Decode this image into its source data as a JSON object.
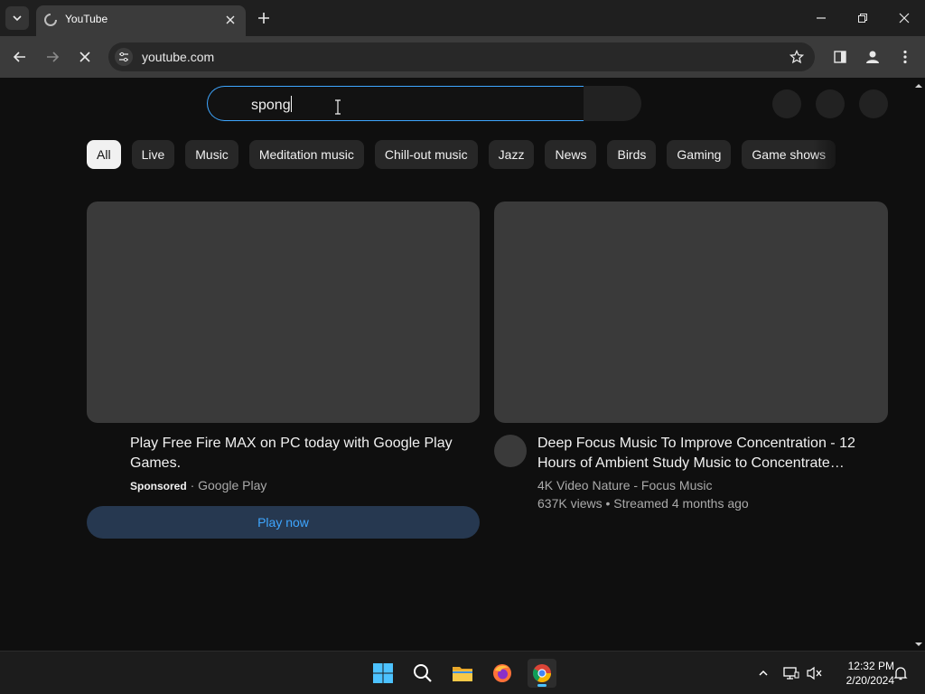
{
  "browser": {
    "tab_title": "YouTube",
    "url": "youtube.com"
  },
  "youtube": {
    "search_query": "spong",
    "chips": [
      "All",
      "Live",
      "Music",
      "Meditation music",
      "Chill-out music",
      "Jazz",
      "News",
      "Birds",
      "Gaming",
      "Game shows"
    ],
    "active_chip": "All",
    "videos": [
      {
        "title": "Play Free Fire MAX on PC today with Google Play Games.",
        "sponsored_label": "Sponsored",
        "separator": "·",
        "advertiser": "Google Play",
        "cta_label": "Play now"
      },
      {
        "title": "Deep Focus Music To Improve Concentration - 12 Hours of Ambient Study Music to Concentrate…",
        "channel": "4K Video Nature - Focus Music",
        "stats": "637K views • Streamed 4 months ago"
      }
    ]
  },
  "taskbar": {
    "time": "12:32 PM",
    "date": "2/20/2024",
    "apps": [
      "windows-start",
      "search",
      "file-explorer",
      "firefox",
      "chrome"
    ],
    "active_app": "chrome"
  },
  "colors": {
    "page_bg": "#0f0f0f",
    "chip_bg": "#272727",
    "accent_blue": "#3ea6ff",
    "chrome_toolbar": "#3b3b3b"
  }
}
